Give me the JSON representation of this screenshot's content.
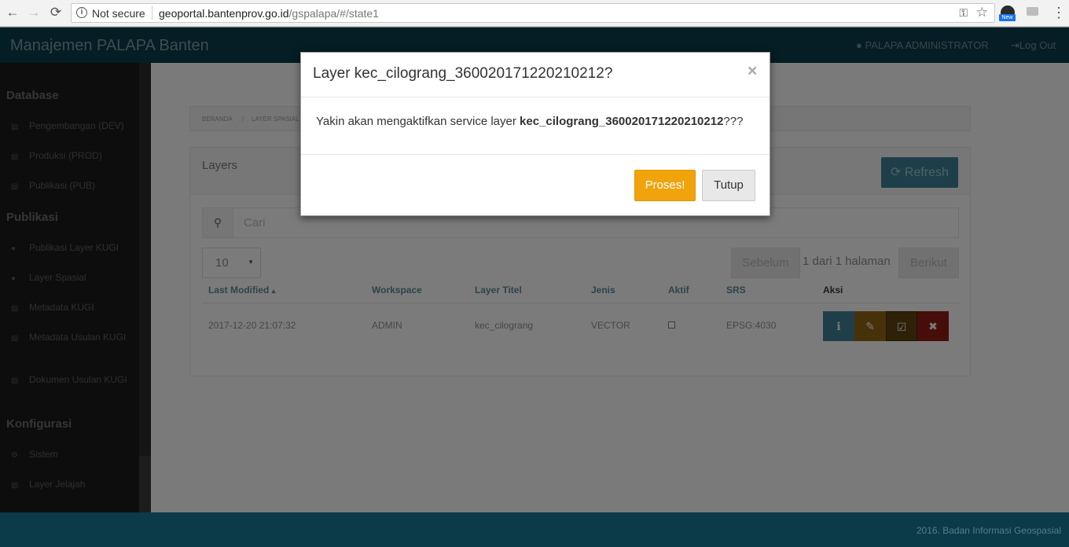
{
  "browser": {
    "back_icon": "←",
    "forward_icon": "→",
    "reload_icon": "⟳",
    "security_label": "Not secure",
    "url_host": "geoportal.bantenprov.go.id",
    "url_path": "/gspalapa/#/state1",
    "ext_badge": "New"
  },
  "header": {
    "title": "Manajemen PALAPA Banten",
    "user": "PALAPA ADMINISTRATOR",
    "logout": "Log Out"
  },
  "sidebar": {
    "sections": [
      {
        "title": "Database"
      },
      {
        "title": "Publikasi"
      },
      {
        "title": "Konfigurasi"
      }
    ],
    "items": [
      {
        "label": "Pengembangan (DEV)",
        "icon": "database-icon"
      },
      {
        "label": "Produksi (PROD)",
        "icon": "database-icon"
      },
      {
        "label": "Publikasi (PUB)",
        "icon": "database-icon"
      },
      {
        "label": "Publikasi Layer KUGI",
        "icon": "globe-icon"
      },
      {
        "label": "Layer Spasial",
        "icon": "globe-icon"
      },
      {
        "label": "Metadata KUGI",
        "icon": "file-icon"
      },
      {
        "label": "Metadata Usulan KUGI",
        "icon": "file-icon"
      },
      {
        "label": "Dokumen Usulan KUGI",
        "icon": "file-icon"
      },
      {
        "label": "Sistem",
        "icon": "cogs-icon"
      },
      {
        "label": "Layer Jelajah",
        "icon": "list-icon"
      }
    ]
  },
  "breadcrumb": [
    "BERANDA",
    "/",
    "LAYER SPASIAL"
  ],
  "panel": {
    "title": "Layers",
    "refresh_label": "Refresh",
    "search_placeholder": "Cari",
    "page_size": "10",
    "prev_label": "Sebelum",
    "page_info": "1 dari 1 halaman",
    "next_label": "Berikut",
    "columns": [
      "Last Modified",
      "Workspace",
      "Layer Titel",
      "Jenis",
      "Aktif",
      "SRS",
      "Aksi"
    ],
    "sort_indicator": "▴",
    "rows": [
      {
        "modified": "2017-12-20 21:07:32",
        "workspace": "ADMIN",
        "title": "kec_cilograng",
        "jenis": "VECTOR",
        "aktif": false,
        "srs": "EPSG:4030"
      }
    ]
  },
  "modal": {
    "title": "Layer kec_cilograng_360020171220210212?",
    "close": "×",
    "body_prefix": "Yakin akan mengaktifkan service layer",
    "body_layer": "kec_cilograng_360020171220210212",
    "body_suffix": "???",
    "proses_label": "Proses!",
    "tutup_label": "Tutup"
  },
  "footer": {
    "text": "2016. Badan Informasi Geospasial"
  },
  "colors": {
    "header_bg": "#0b3a48",
    "sidebar_bg": "#1b1b1b",
    "proses_btn": "#f0a30a",
    "info_btn": "#3d7e93",
    "edit_btn": "#8e6312",
    "delete_btn": "#8f1a15"
  }
}
